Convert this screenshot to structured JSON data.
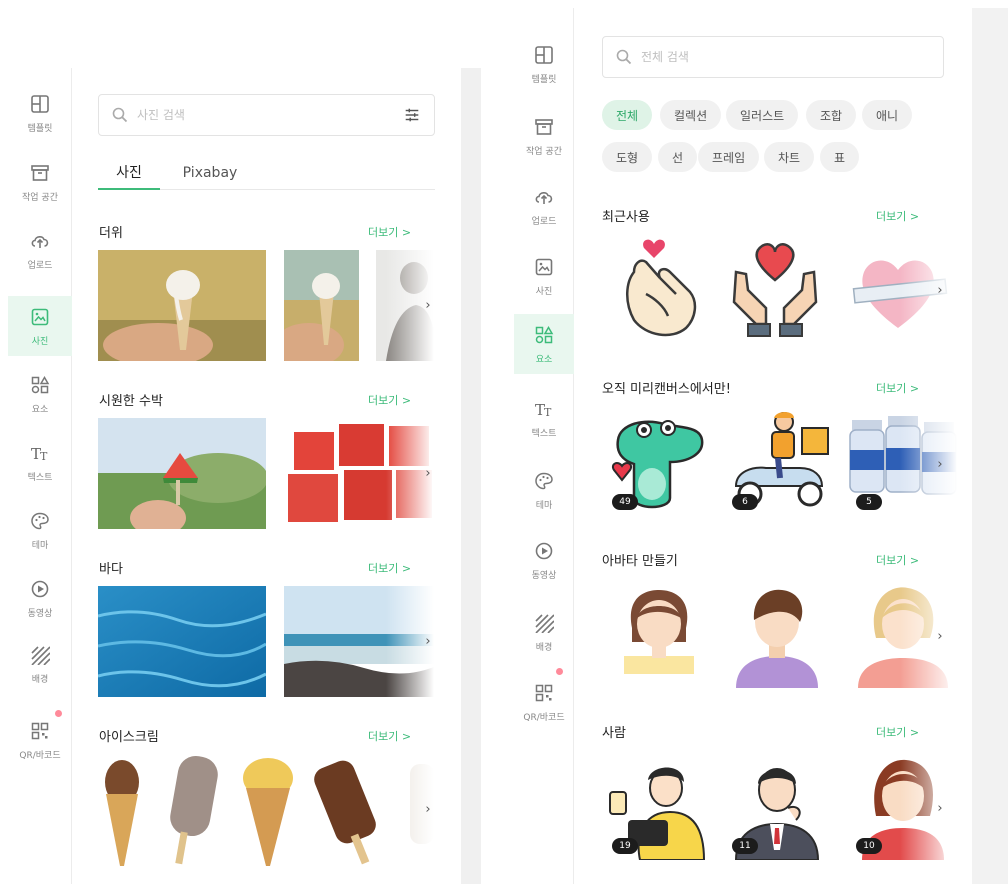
{
  "left_panel": {
    "rail": [
      {
        "label": "템플릿",
        "icon": "template-icon"
      },
      {
        "label": "작업 공간",
        "icon": "workspace-box-icon"
      },
      {
        "label": "업로드",
        "icon": "upload-cloud-icon"
      },
      {
        "label": "사진",
        "icon": "photo-icon",
        "active": true
      },
      {
        "label": "요소",
        "icon": "elements-icon"
      },
      {
        "label": "텍스트",
        "icon": "text-icon"
      },
      {
        "label": "테마",
        "icon": "palette-icon"
      },
      {
        "label": "동영상",
        "icon": "video-play-icon"
      },
      {
        "label": "배경",
        "icon": "background-pattern-icon"
      },
      {
        "label": "QR/바코드",
        "icon": "qr-code-icon"
      }
    ],
    "search": {
      "placeholder": "사진 검색",
      "icon": "search-icon",
      "filter_icon": "filter-sliders-icon"
    },
    "tabs": [
      {
        "label": "사진",
        "active": true
      },
      {
        "label": "Pixabay",
        "active": false
      }
    ],
    "sections": [
      {
        "title": "더위",
        "more": "더보기 >"
      },
      {
        "title": "시원한 수박",
        "more": "더보기 >"
      },
      {
        "title": "바다",
        "more": "더보기 >"
      },
      {
        "title": "아이스크림",
        "more": "더보기 >"
      }
    ]
  },
  "right_panel": {
    "rail": [
      {
        "label": "템플릿",
        "icon": "template-icon"
      },
      {
        "label": "작업 공간",
        "icon": "workspace-box-icon"
      },
      {
        "label": "업로드",
        "icon": "upload-cloud-icon"
      },
      {
        "label": "사진",
        "icon": "photo-icon"
      },
      {
        "label": "요소",
        "icon": "elements-icon",
        "active": true
      },
      {
        "label": "텍스트",
        "icon": "text-icon"
      },
      {
        "label": "테마",
        "icon": "palette-icon"
      },
      {
        "label": "동영상",
        "icon": "video-play-icon"
      },
      {
        "label": "배경",
        "icon": "background-pattern-icon"
      },
      {
        "label": "QR/바코드",
        "icon": "qr-code-icon"
      }
    ],
    "search": {
      "placeholder": "전체 검색",
      "icon": "search-icon"
    },
    "chips": [
      {
        "label": "전체",
        "active": true
      },
      {
        "label": "컬렉션"
      },
      {
        "label": "일러스트"
      },
      {
        "label": "조합"
      },
      {
        "label": "애니"
      },
      {
        "label": "도형"
      },
      {
        "label": "선"
      },
      {
        "label": "프레임"
      },
      {
        "label": "차트"
      },
      {
        "label": "표"
      }
    ],
    "sections": [
      {
        "title": "최근사용",
        "more": "더보기 >",
        "badges": []
      },
      {
        "title": "오직 미리캔버스에서만!",
        "more": "더보기 >",
        "badges": [
          "49",
          "6",
          "5"
        ]
      },
      {
        "title": "아바타 만들기",
        "more": "더보기 >",
        "badges": []
      },
      {
        "title": "사람",
        "more": "더보기 >",
        "badges": [
          "19",
          "11",
          "10"
        ]
      }
    ]
  },
  "colors": {
    "accent": "#3dbb7a",
    "active_bg": "#e9f7ef",
    "chip_bg": "#f1f1f1",
    "badge_bg": "#1c1c1c"
  }
}
